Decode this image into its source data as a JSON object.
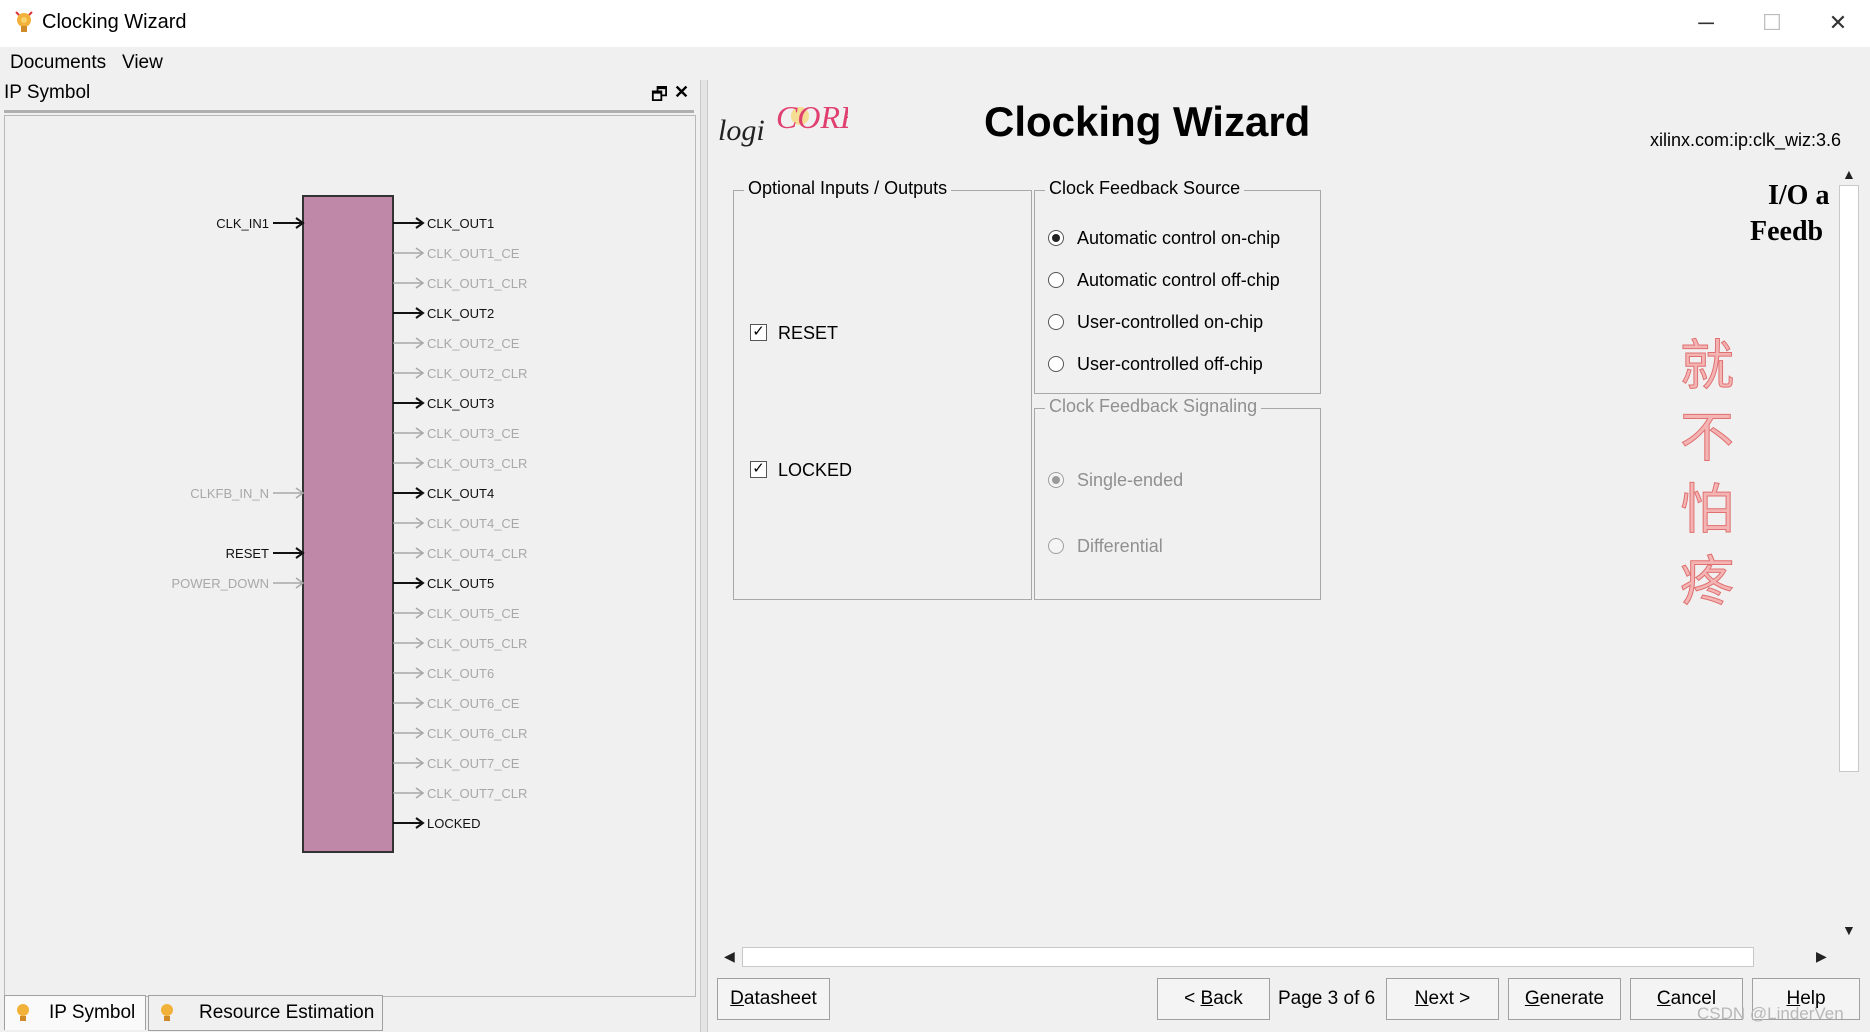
{
  "window": {
    "title": "Clocking Wizard",
    "controls": {
      "minimize": "─",
      "maximize": "☐",
      "close": "✕"
    }
  },
  "menu": {
    "items": [
      "Documents",
      "View"
    ]
  },
  "left_panel": {
    "header": "IP Symbol",
    "float_icon": "🗗",
    "close_icon": "✕",
    "block_color": "#c088a8",
    "inputs": [
      {
        "label": "CLK_IN1",
        "active": true
      },
      {
        "label": "CLKFB_IN_N",
        "active": false
      },
      {
        "label": "RESET",
        "active": true
      },
      {
        "label": "POWER_DOWN",
        "active": false
      }
    ],
    "outputs": [
      {
        "label": "CLK_OUT1",
        "active": true
      },
      {
        "label": "CLK_OUT1_CE",
        "active": false
      },
      {
        "label": "CLK_OUT1_CLR",
        "active": false
      },
      {
        "label": "CLK_OUT2",
        "active": true
      },
      {
        "label": "CLK_OUT2_CE",
        "active": false
      },
      {
        "label": "CLK_OUT2_CLR",
        "active": false
      },
      {
        "label": "CLK_OUT3",
        "active": true
      },
      {
        "label": "CLK_OUT3_CE",
        "active": false
      },
      {
        "label": "CLK_OUT3_CLR",
        "active": false
      },
      {
        "label": "CLK_OUT4",
        "active": true
      },
      {
        "label": "CLK_OUT4_CE",
        "active": false
      },
      {
        "label": "CLK_OUT4_CLR",
        "active": false
      },
      {
        "label": "CLK_OUT5",
        "active": true
      },
      {
        "label": "CLK_OUT5_CE",
        "active": false
      },
      {
        "label": "CLK_OUT5_CLR",
        "active": false
      },
      {
        "label": "CLK_OUT6",
        "active": false
      },
      {
        "label": "CLK_OUT6_CE",
        "active": false
      },
      {
        "label": "CLK_OUT6_CLR",
        "active": false
      },
      {
        "label": "CLK_OUT7_CE",
        "active": false
      },
      {
        "label": "CLK_OUT7_CLR",
        "active": false
      },
      {
        "label": "LOCKED",
        "active": true
      }
    ],
    "tabs": [
      "IP Symbol",
      "Resource Estimation"
    ]
  },
  "right_panel": {
    "logo_text": {
      "part1": "logi",
      "part2": "CORE"
    },
    "title": "Clocking Wizard",
    "ip_id": "xilinx.com:ip:clk_wiz:3.6",
    "optional_io": {
      "title": "Optional Inputs / Outputs",
      "reset": {
        "label": "RESET",
        "checked": true
      },
      "locked": {
        "label": "LOCKED",
        "checked": true
      }
    },
    "feedback_source": {
      "title": "Clock Feedback Source",
      "options": [
        {
          "label": "Automatic control on-chip",
          "selected": true
        },
        {
          "label": "Automatic control off-chip",
          "selected": false
        },
        {
          "label": "User-controlled on-chip",
          "selected": false
        },
        {
          "label": "User-controlled off-chip",
          "selected": false
        }
      ]
    },
    "feedback_signaling": {
      "title": "Clock Feedback Signaling",
      "options": [
        {
          "label": "Single-ended",
          "selected": true
        },
        {
          "label": "Differential",
          "selected": false
        }
      ]
    },
    "side_heading": {
      "line1": "I/O a",
      "line2": "Feedb"
    },
    "watermark": [
      "就",
      "不",
      "怕",
      "疼"
    ]
  },
  "footer": {
    "datasheet": {
      "pre": "",
      "key": "D",
      "post": "atasheet"
    },
    "back": {
      "pre": "< ",
      "key": "B",
      "post": "ack"
    },
    "page": "Page 3 of 6",
    "next": {
      "pre": "",
      "key": "N",
      "post": "ext >"
    },
    "generate": {
      "pre": "",
      "key": "G",
      "post": "enerate"
    },
    "cancel": {
      "pre": "",
      "key": "C",
      "post": "ancel"
    },
    "help": {
      "pre": "",
      "key": "H",
      "post": "elp"
    }
  },
  "overlay": {
    "csdn": "CSDN @LinderVen"
  }
}
